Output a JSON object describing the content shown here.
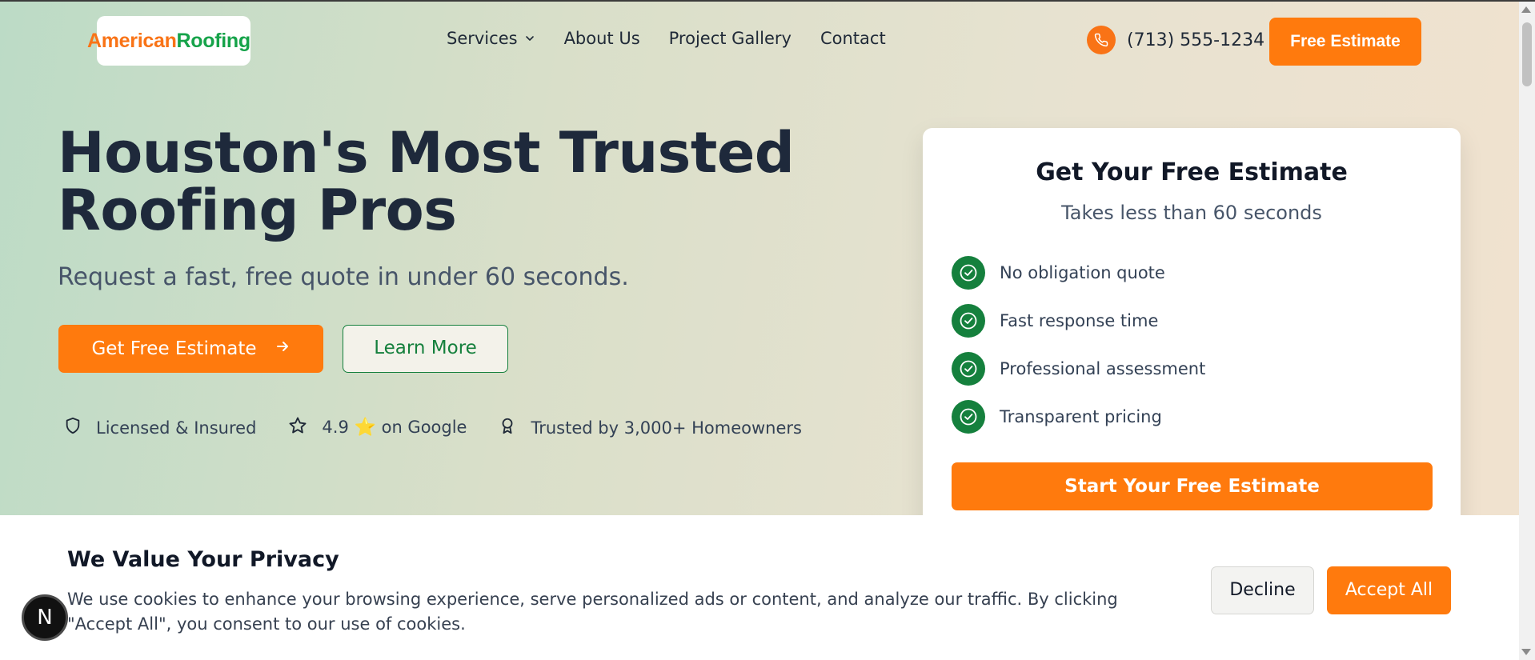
{
  "brand": {
    "part1": "American",
    "part2": "Roofing",
    "color_primary": "#f97316",
    "color_secondary": "#16a34a"
  },
  "nav": {
    "items": [
      {
        "label": "Services",
        "has_dropdown": true
      },
      {
        "label": "About Us"
      },
      {
        "label": "Project Gallery"
      },
      {
        "label": "Contact"
      }
    ]
  },
  "header": {
    "phone": "(713) 555-1234",
    "cta": "Free Estimate"
  },
  "hero": {
    "title_line1": "Houston's Most Trusted",
    "title_line2": "Roofing Pros",
    "subtitle": "Request a fast, free quote in under 60 seconds.",
    "primary_button": "Get Free Estimate",
    "secondary_button": "Learn More",
    "trust": {
      "licensed": "Licensed & Insured",
      "rating_value": "4.9",
      "rating_star": "⭐",
      "rating_suffix": "on Google",
      "trusted": "Trusted by 3,000+ Homeowners"
    }
  },
  "estimate_card": {
    "title": "Get Your Free Estimate",
    "subtitle": "Takes less than 60 seconds",
    "features": [
      "No obligation quote",
      "Fast response time",
      "Professional assessment",
      "Transparent pricing"
    ],
    "cta": "Start Your Free Estimate"
  },
  "cookie_banner": {
    "title": "We Value Your Privacy",
    "text": "We use cookies to enhance your browsing experience, serve personalized ads or content, and analyze our traffic. By clicking \"Accept All\", you consent to our use of cookies.",
    "decline": "Decline",
    "accept": "Accept All"
  },
  "dev_badge": {
    "letter": "N"
  },
  "colors": {
    "accent": "#ff7a0d",
    "green": "#15803d",
    "dark": "#1e293b"
  }
}
